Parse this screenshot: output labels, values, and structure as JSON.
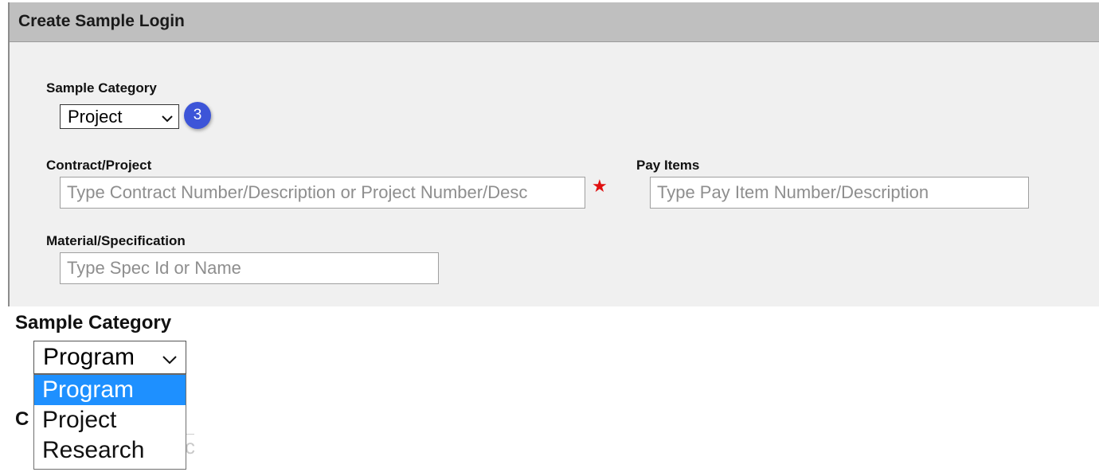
{
  "panel": {
    "title": "Create Sample Login",
    "sample_category": {
      "label": "Sample Category",
      "value": "Project",
      "badge": "3"
    },
    "contract_project": {
      "label": "Contract/Project",
      "placeholder": "Type Contract Number/Description or Project Number/Desc",
      "required_mark": "★"
    },
    "pay_items": {
      "label": "Pay Items",
      "placeholder": "Type Pay Item Number/Description"
    },
    "material_spec": {
      "label": "Material/Specification",
      "placeholder": "Type Spec Id or Name"
    }
  },
  "zoom_inset": {
    "label": "Sample Category",
    "selected_value": "Program",
    "options": [
      "Program",
      "Project",
      "Research"
    ],
    "behind_label_fragment": "C",
    "behind_field_fragment": "c"
  },
  "colors": {
    "header_bg": "#bfbfbf",
    "panel_bg": "#f0f0f0",
    "badge_bg": "#3d55d8",
    "option_highlight": "#1e90ff",
    "required_star": "#e01010"
  },
  "icons": {
    "dropdown": "chevron-down-icon",
    "required": "required-star-icon"
  }
}
